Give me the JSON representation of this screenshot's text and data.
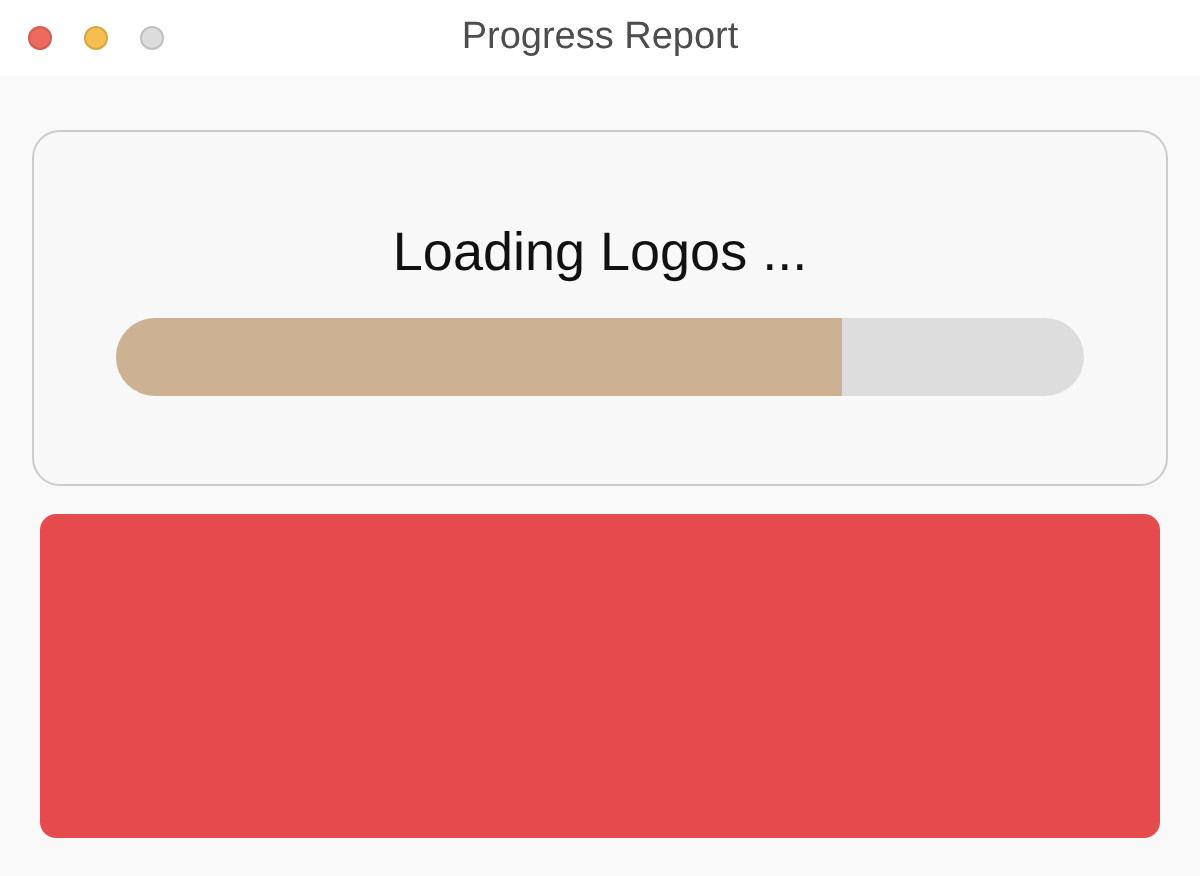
{
  "window": {
    "title": "Progress Report"
  },
  "progress": {
    "label": "Loading Logos ...",
    "level": 0.75
  }
}
